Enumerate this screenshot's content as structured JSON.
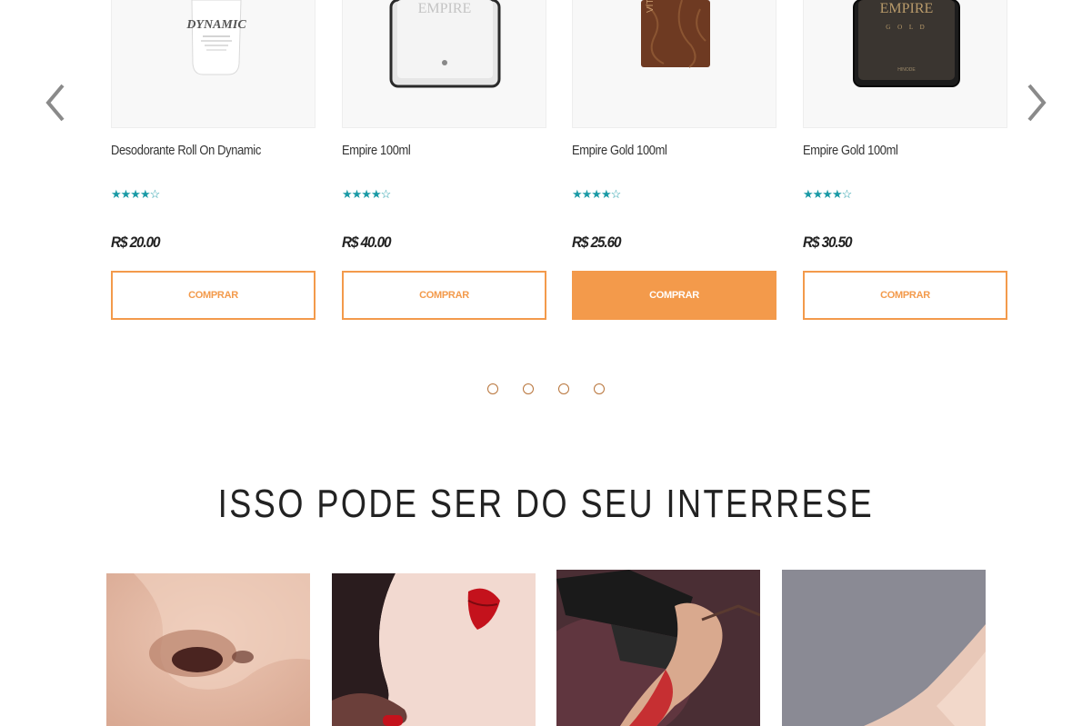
{
  "carousel": {
    "prev_icon": "chevron-left-icon",
    "next_icon": "chevron-right-icon",
    "products": [
      {
        "name": "Desodorante Roll On Dynamic",
        "rating": 4,
        "max_rating": 5,
        "stars": "★★★★☆",
        "price": "R$ 20.00",
        "button": "COMPRAR",
        "highlighted": false,
        "image_label": "DYNAMIC"
      },
      {
        "name": "Empire 100ml",
        "rating": 4,
        "max_rating": 5,
        "stars": "★★★★☆",
        "price": "R$ 40.00",
        "button": "COMPRAR",
        "highlighted": false,
        "image_label": "EMPIRE"
      },
      {
        "name": "Empire Gold 100ml",
        "rating": 4,
        "max_rating": 5,
        "stars": "★★★★☆",
        "price": "R$ 25.60",
        "button": "COMPRAR",
        "highlighted": true,
        "image_label": "VITTIO"
      },
      {
        "name": "Empire Gold 100ml",
        "rating": 4,
        "max_rating": 5,
        "stars": "★★★★☆",
        "price": "R$ 30.50",
        "button": "COMPRAR",
        "highlighted": false,
        "image_label": "EMPIRE"
      }
    ],
    "dots_count": 4
  },
  "interest": {
    "title": "ISSO PODE SER DO SEU INTERRESE"
  },
  "colors": {
    "accent": "#f39a4b",
    "star": "#1a9aa6",
    "dot": "#b8743a"
  }
}
